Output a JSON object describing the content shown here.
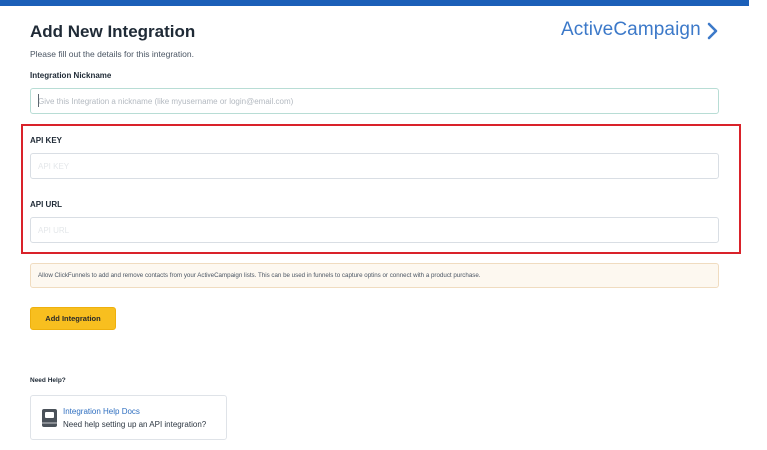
{
  "header": {
    "title": "Add New Integration",
    "subtitle": "Please fill out the details for this integration.",
    "brand": "ActiveCampaign",
    "brand_color": "#3c79c9"
  },
  "form": {
    "nickname": {
      "label": "Integration Nickname",
      "value": "",
      "placeholder": "Give this Integration a nickname (like myusername or login@email.com)"
    },
    "api_key": {
      "label": "API KEY",
      "value": "",
      "placeholder": "API KEY"
    },
    "api_url": {
      "label": "API URL",
      "value": "",
      "placeholder": "API URL"
    }
  },
  "notice": {
    "text": "Allow ClickFunnels to add and remove contacts from your ActiveCampaign lists. This can be used in funnels to capture optins or connect with a product purchase."
  },
  "actions": {
    "add_label": "Add Integration",
    "add_color": "#f8bf1f"
  },
  "help": {
    "heading": "Need Help?",
    "card_title": "Integration Help Docs",
    "card_desc": "Need help setting up an API integration?",
    "icon": "book-icon"
  },
  "colors": {
    "top_bar": "#1b5fb8",
    "highlight": "#d9222a"
  }
}
